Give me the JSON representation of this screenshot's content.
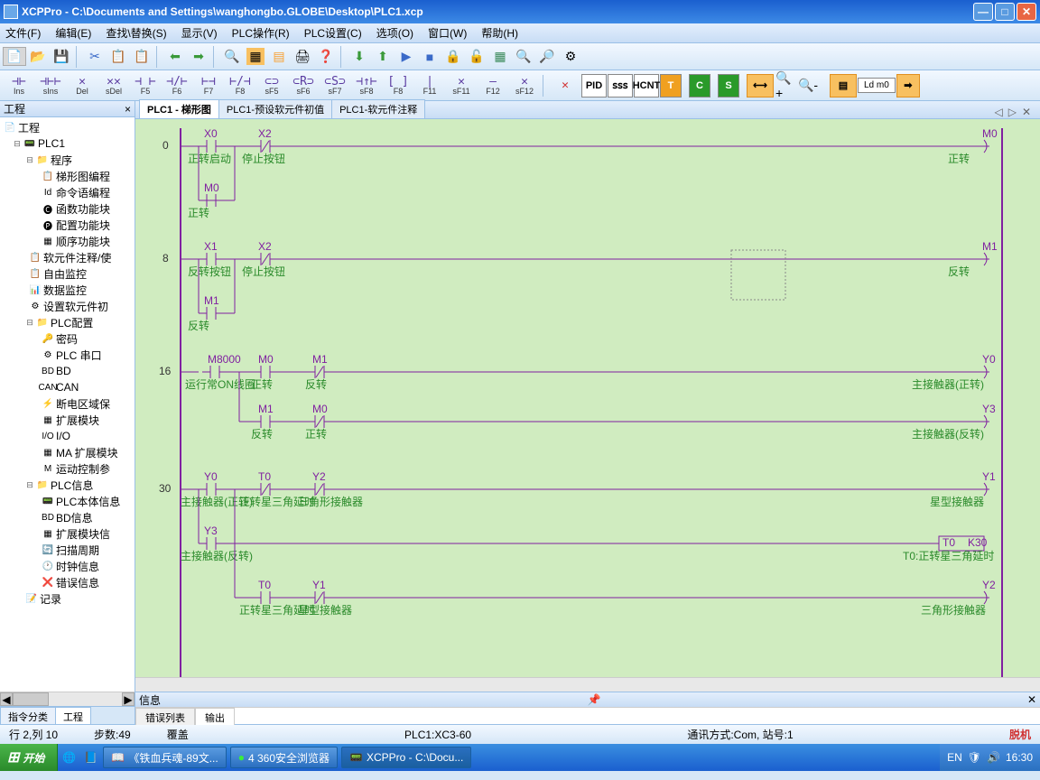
{
  "title": "XCPPro - C:\\Documents and Settings\\wanghongbo.GLOBE\\Desktop\\PLC1.xcp",
  "menu": [
    "文件(F)",
    "编辑(E)",
    "查找\\替换(S)",
    "显示(V)",
    "PLC操作(R)",
    "PLC设置(C)",
    "选项(O)",
    "窗口(W)",
    "帮助(H)"
  ],
  "ladderBtns": [
    {
      "sym": "⊣⊢",
      "lbl": "Ins"
    },
    {
      "sym": "⊣⊢⊢",
      "lbl": "sIns"
    },
    {
      "sym": "✕",
      "lbl": "Del"
    },
    {
      "sym": "✕✕",
      "lbl": "sDel"
    },
    {
      "sym": "⊣ ⊢",
      "lbl": "F5"
    },
    {
      "sym": "⊣/⊢",
      "lbl": "F6"
    },
    {
      "sym": "⊢⊣",
      "lbl": "F7"
    },
    {
      "sym": "⊢/⊣",
      "lbl": "F8"
    },
    {
      "sym": "⊂⊃",
      "lbl": "sF5"
    },
    {
      "sym": "⊂R⊃",
      "lbl": "sF6"
    },
    {
      "sym": "⊂S⊃",
      "lbl": "sF7"
    },
    {
      "sym": "⊣↑⊢",
      "lbl": "sF8"
    },
    {
      "sym": "[ ]",
      "lbl": "F8"
    },
    {
      "sym": "|",
      "lbl": "F11"
    },
    {
      "sym": "✕",
      "lbl": "sF11"
    },
    {
      "sym": "—",
      "lbl": "F12"
    },
    {
      "sym": "✕",
      "lbl": "sF12"
    }
  ],
  "bigBtns": [
    "PID",
    "𝗌𝗌𝗌",
    "HCNT"
  ],
  "sidebar": {
    "title": "工程",
    "hdr_x": "×"
  },
  "tree": {
    "root": "工程",
    "plc": "PLC1",
    "prog": "程序",
    "prog_items": [
      "梯形图编程",
      "命令语编程",
      "函数功能块",
      "配置功能块",
      "顺序功能块"
    ],
    "items2": [
      "软元件注释/使",
      "自由监控",
      "数据监控",
      "设置软元件初"
    ],
    "cfg": "PLC配置",
    "cfg_items": [
      "密码",
      "PLC 串口",
      "BD",
      "CAN",
      "断电区域保",
      "扩展模块",
      "I/O",
      "MA 扩展模块",
      "运动控制参"
    ],
    "info": "PLC信息",
    "info_items": [
      "PLC本体信息",
      "BD信息",
      "扩展模块信",
      "扫描周期",
      "时钟信息",
      "错误信息"
    ],
    "rec": "记录"
  },
  "sideTabs": [
    "指令分类",
    "工程"
  ],
  "docTabs": [
    "PLC1 - 梯形图",
    "PLC1-预设软元件初值",
    "PLC1-软元件注释"
  ],
  "ladder": {
    "rows": [
      "0",
      "8",
      "16",
      "30"
    ],
    "contacts": {
      "r0": {
        "x0": "X0",
        "x2": "X2",
        "m0_out": "M0",
        "m0_in": "M0"
      },
      "r0_lbl": {
        "a": "正转启动",
        "b": "停止按钮",
        "c": "正转",
        "d": "正转"
      },
      "r1": {
        "x1": "X1",
        "x2": "X2",
        "m1_out": "M1",
        "m1_in": "M1"
      },
      "r1_lbl": {
        "a": "反转按钮",
        "b": "停止按钮",
        "c": "反转",
        "d": "反转"
      },
      "r2": {
        "m8000": "M8000",
        "m0": "M0",
        "m1": "M1",
        "y0": "Y0",
        "m1b": "M1",
        "m0b": "M0",
        "y3": "Y3"
      },
      "r2_lbl": {
        "a": "运行常ON线圈",
        "b": "正转",
        "c": "反转",
        "d": "主接触器(正转)",
        "e": "反转",
        "f": "正转",
        "g": "主接触器(反转)"
      },
      "r3": {
        "y0": "Y0",
        "t0": "T0",
        "y2": "Y2",
        "y1": "Y1",
        "y3": "Y3",
        "t0b": "T0",
        "k30": "K30",
        "t0c": "T0",
        "y1b": "Y1",
        "y2b": "Y2"
      },
      "r3_lbl": {
        "a": "主接触器(正转)",
        "b": "正转星三角延时",
        "c": "三角形接触器",
        "d": "星型接触器",
        "e": "主接触器(反转)",
        "f": "T0:正转星三角延时",
        "g": "正转星三角延时",
        "h": "星型接触器",
        "i": "三角形接触器"
      }
    }
  },
  "info": {
    "title": "信息",
    "tabs": [
      "错误列表",
      "输出"
    ]
  },
  "status": {
    "pos": "行 2,列 10",
    "steps": "步数:49",
    "mode": "覆盖",
    "plc": "PLC1:XC3-60",
    "comm": "通讯方式:Com, 站号:1",
    "state": "脱机"
  },
  "taskbar": {
    "start": "开始",
    "items": [
      "《铁血兵魂-89文...",
      "4 360安全浏览器",
      "XCPPro - C:\\Docu..."
    ],
    "tray": {
      "ime": "EN",
      "time": "16:30"
    }
  },
  "ldbox": "Ld m0"
}
